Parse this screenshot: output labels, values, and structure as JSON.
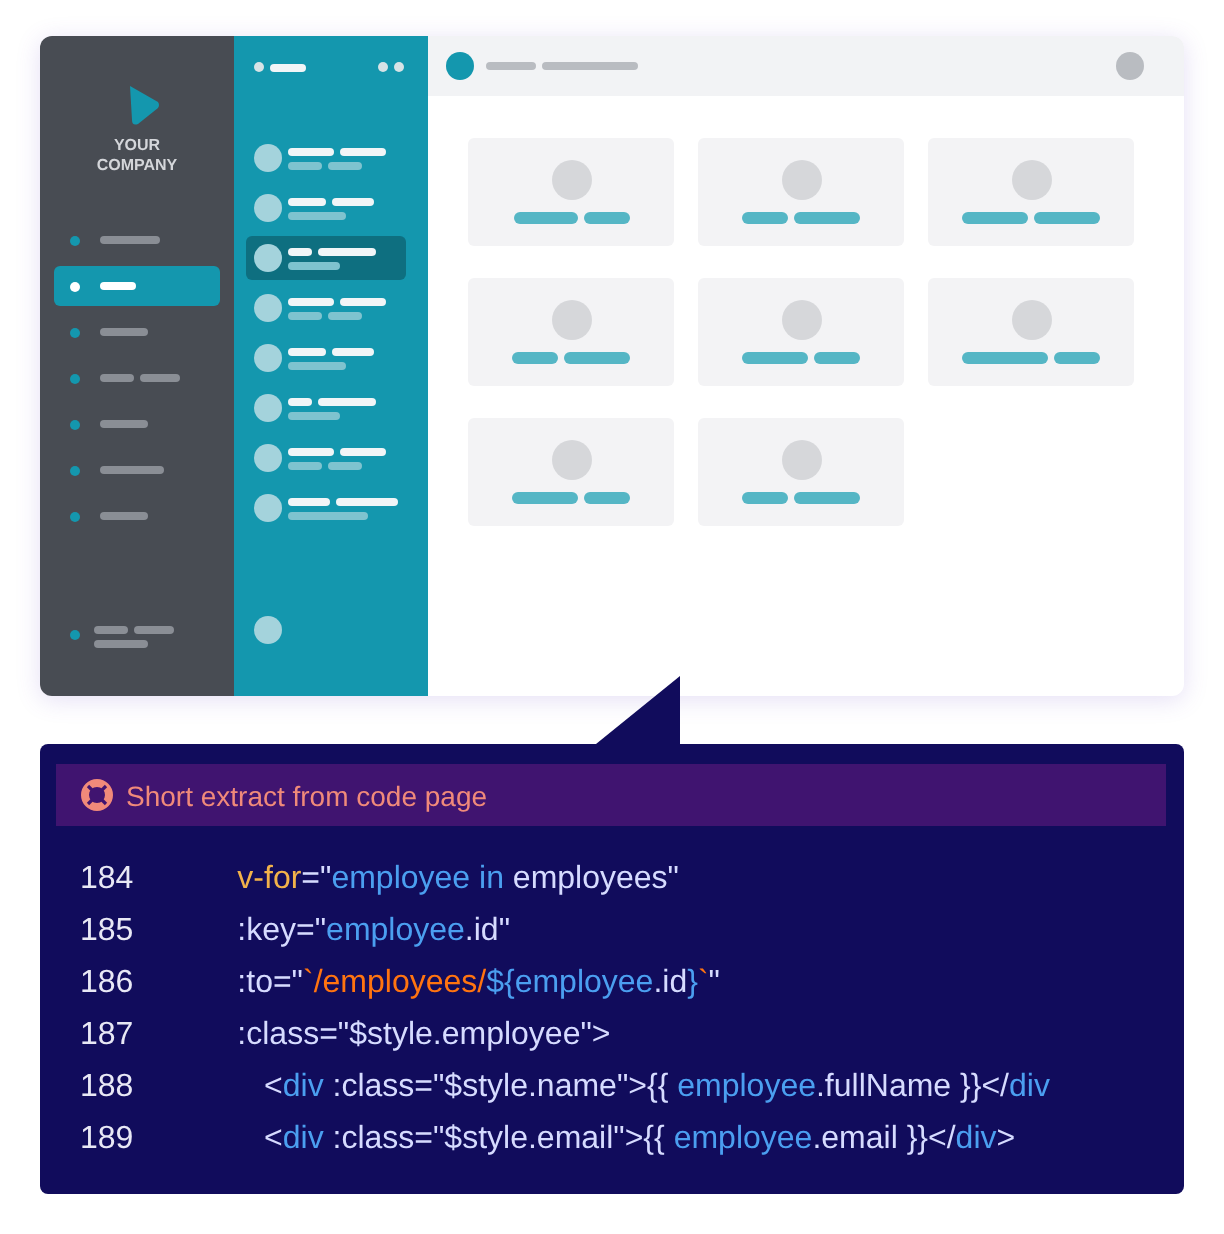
{
  "sidebar": {
    "company": "YOUR\nCOMPANY",
    "nav_items": [
      {
        "selected": false
      },
      {
        "selected": true
      },
      {
        "selected": false
      },
      {
        "selected": false
      },
      {
        "selected": false
      },
      {
        "selected": false
      },
      {
        "selected": false
      }
    ]
  },
  "list": {
    "items": [
      {
        "selected": false
      },
      {
        "selected": false
      },
      {
        "selected": true
      },
      {
        "selected": false
      },
      {
        "selected": false
      },
      {
        "selected": false
      },
      {
        "selected": false
      },
      {
        "selected": false
      }
    ]
  },
  "notice": {
    "text": "Short extract from code page"
  },
  "code": {
    "lines": [
      {
        "number": "184",
        "tokens": [
          {
            "kind": "attr",
            "text": "      v-for"
          },
          {
            "kind": "plain",
            "text": "=\""
          },
          {
            "kind": "name",
            "text": "employee in"
          },
          {
            "kind": "plain",
            "text": " employees\""
          }
        ]
      },
      {
        "number": "185",
        "tokens": [
          {
            "kind": "plain",
            "text": "      :key=\""
          },
          {
            "kind": "name",
            "text": "employee"
          },
          {
            "kind": "plain",
            "text": ".id\""
          }
        ]
      },
      {
        "number": "186",
        "tokens": [
          {
            "kind": "plain",
            "text": "      :to=\""
          },
          {
            "kind": "template",
            "text": "`/employees/"
          },
          {
            "kind": "name",
            "text": "${employee"
          },
          {
            "kind": "plain",
            "text": ".id"
          },
          {
            "kind": "name",
            "text": "}"
          },
          {
            "kind": "template",
            "text": "`"
          },
          {
            "kind": "plain",
            "text": "\""
          }
        ]
      },
      {
        "number": "187",
        "tokens": [
          {
            "kind": "plain",
            "text": "      :class=\"$style.employee\">"
          }
        ]
      },
      {
        "number": "188",
        "tokens": [
          {
            "kind": "plain",
            "text": "         <"
          },
          {
            "kind": "name",
            "text": "div"
          },
          {
            "kind": "plain",
            "text": " :class=\"$style.name\">{{ "
          },
          {
            "kind": "name",
            "text": "employee"
          },
          {
            "kind": "plain",
            "text": ".fullName }}</"
          },
          {
            "kind": "name",
            "text": "div"
          }
        ]
      },
      {
        "number": "189",
        "tokens": [
          {
            "kind": "plain",
            "text": "         <"
          },
          {
            "kind": "name",
            "text": "div"
          },
          {
            "kind": "plain",
            "text": " :class=\"$style.email\">{{ "
          },
          {
            "kind": "name",
            "text": "employee"
          },
          {
            "kind": "plain",
            "text": ".email }}</"
          },
          {
            "kind": "name",
            "text": "div"
          },
          {
            "kind": "plain",
            "text": ">"
          }
        ]
      }
    ]
  }
}
